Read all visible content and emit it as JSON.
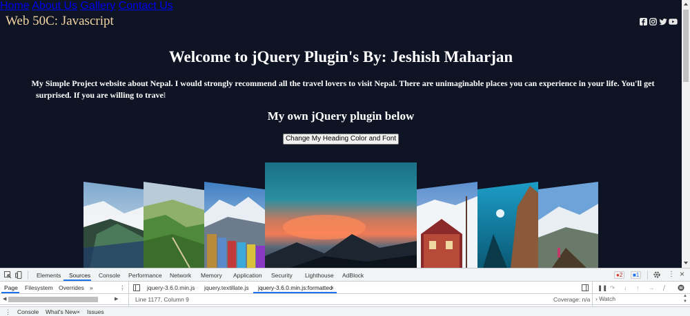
{
  "site": {
    "title": "Web 50C: Javascript",
    "nav": [
      "Home",
      "About Us",
      "Gallery",
      "Contact Us"
    ],
    "social_icons": [
      "facebook-icon",
      "instagram-icon",
      "twitter-icon",
      "youtube-icon"
    ],
    "heading": "Welcome to jQuery Plugin's By: Jeshish Maharjan",
    "intro_line1": "My Simple Project website about Nepal. I would strongly recommend all the travel lovers to visit Nepal. There are unimaginable places you can experience in your life. You'll get",
    "intro_line2_a": "surprised. If you are willing to trave",
    "intro_line2_b": "l",
    "sub_heading": "My own jQuery plugin below",
    "button_label": "Change My Heading Color and Font",
    "colors": {
      "page_bg": "#0f1424",
      "title": "#f3d6a3",
      "text": "#ffffff"
    }
  },
  "devtools": {
    "tabs": [
      "Elements",
      "Sources",
      "Console",
      "Performance",
      "Network",
      "Memory",
      "Application",
      "Security",
      "Lighthouse",
      "AdBlock"
    ],
    "active_tab": "Sources",
    "more_tabs": "»",
    "errors_count": "2",
    "messages_count": "1",
    "navigator_tabs": [
      "Page",
      "Filesystem",
      "Overrides"
    ],
    "navigator_more": "»",
    "file_tabs": [
      "jquery-3.6.0.min.js",
      "jquery.textillate.js",
      "jquery-3.6.0.min.js:formatted"
    ],
    "file_close": "×",
    "status_position": "Line 1177, Column 9",
    "coverage": "Coverage: n/a",
    "watch_label": "Watch",
    "drawer_tabs": [
      "Console",
      "What's New",
      "Issues"
    ],
    "drawer_close": "×",
    "close_icon": "×",
    "accent": "#1a73e8"
  }
}
